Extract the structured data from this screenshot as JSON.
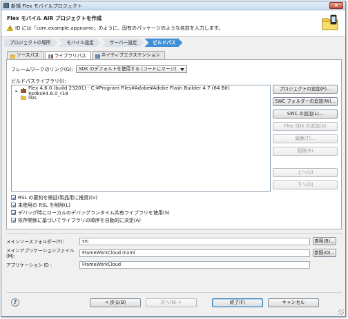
{
  "window": {
    "title": "新規 Flex モバイルプロジェクト"
  },
  "header": {
    "title": "Flex モバイル AIR プロジェクトを作成",
    "message": "ID には「com.example.appname」のように、固有のパッケージのような名前を入力します。"
  },
  "crumbs": [
    "プロジェクトの場所",
    "モバイル設定",
    "サーバー設定",
    "ビルドパス"
  ],
  "tabs": [
    "ソースパス",
    "ライブラリパス",
    "ネイティブエクステンション"
  ],
  "library": {
    "framework_label": "フレームワークのリンク(G):",
    "framework_value": "SDK のデフォルトを使用する (コードにマージ)",
    "buildpath_label": "ビルドパスライブラリ(I):",
    "tree": [
      "Flex 4.6.0 (build 23201) - C:¥Program Files¥Adobe¥Adobe Flash Builder 4.7 (64 Bit)¥sdks¥4.6.0_r18",
      "libs"
    ],
    "buttons": [
      {
        "label": "プロジェクトの追加(F)...",
        "enabled": true
      },
      {
        "label": "SWC フォルダーの追加(W)...",
        "enabled": true
      },
      {
        "label": "SWC の追加(L)...",
        "enabled": true
      },
      {
        "label": "Flex SDK の追加(X)",
        "enabled": false
      },
      {
        "label": "編集(T)...",
        "enabled": false
      },
      {
        "label": "削除(R)",
        "enabled": false
      },
      {
        "label": "上へ(U)",
        "enabled": false
      },
      {
        "label": "下へ(D)",
        "enabled": false
      }
    ],
    "checkboxes": [
      "RSL の要約を検証(製品用に推奨)(V)",
      "未使用の RSL を削除(L)",
      "デバッグ時にローカルのデバッグランタイム共有ライブラリを使用(S)",
      "依存関係に基づいてライブラリの順序を自動的に決定(A)"
    ]
  },
  "fields": {
    "main_source_label": "メインソースフォルダー(Y):",
    "main_source_value": "src",
    "main_app_label": "メインアプリケーションファイル(M):",
    "main_app_value": "FrameWorkCloud.mxml",
    "app_id_label": "アプリケーション ID :",
    "app_id_value": "FrameWorkCloud",
    "browse_label": "参照(B)...",
    "browse2_label": "参照(O)..."
  },
  "footer": {
    "help": "?",
    "back": "< 戻る(B)",
    "next": "次へ(N) >",
    "finish": "終了(F)",
    "cancel": "キャンセル"
  },
  "colors": {
    "crumb_active": "#3f8fd6",
    "title_bar": "#c9dbee"
  }
}
